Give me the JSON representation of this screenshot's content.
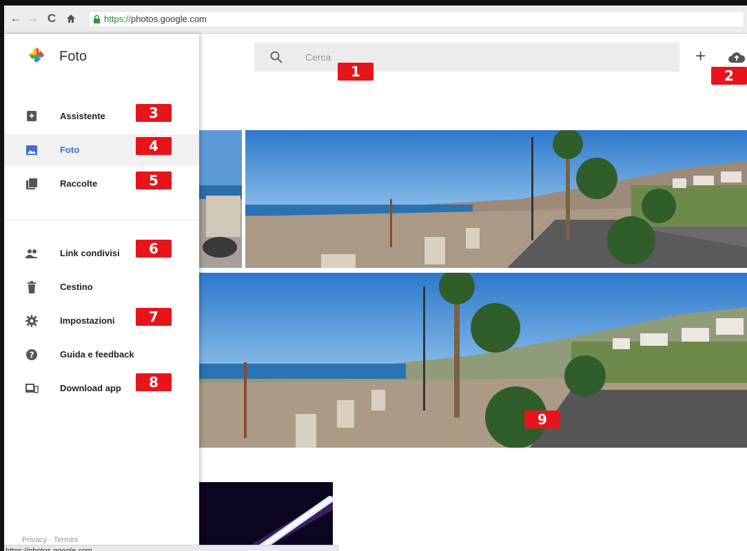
{
  "browser": {
    "url_scheme": "https://",
    "url_host": "photos.google.com",
    "status_url": "https://photos.google.com",
    "back_icon": "arrow-left-icon",
    "forward_icon": "arrow-right-icon",
    "reload_icon": "reload-icon",
    "home_icon": "home-icon"
  },
  "sidebar": {
    "title": "Foto",
    "items": [
      {
        "label": "Assistente",
        "icon": "assistant-icon",
        "active": false
      },
      {
        "label": "Foto",
        "icon": "photo-icon",
        "active": true
      },
      {
        "label": "Raccolte",
        "icon": "collections-icon",
        "active": false
      },
      {
        "label": "Link condivisi",
        "icon": "people-icon",
        "active": false
      },
      {
        "label": "Cestino",
        "icon": "trash-icon",
        "active": false
      },
      {
        "label": "Impostazioni",
        "icon": "gear-icon",
        "active": false
      },
      {
        "label": "Guida e feedback",
        "icon": "help-icon",
        "active": false
      },
      {
        "label": "Download app",
        "icon": "devices-icon",
        "active": false
      }
    ],
    "footer": {
      "privacy": "Privacy",
      "separator": "·",
      "terms": "Termini"
    }
  },
  "search": {
    "placeholder": "Cerca"
  },
  "toolbar": {
    "add": "+",
    "upload_icon": "cloud-upload-icon"
  },
  "badges": [
    "1",
    "2",
    "3",
    "4",
    "5",
    "6",
    "7",
    "8",
    "9"
  ],
  "colors": {
    "badge": "#e8141b",
    "active_label": "#3f6fcf",
    "url_scheme": "#1a8f2e"
  }
}
